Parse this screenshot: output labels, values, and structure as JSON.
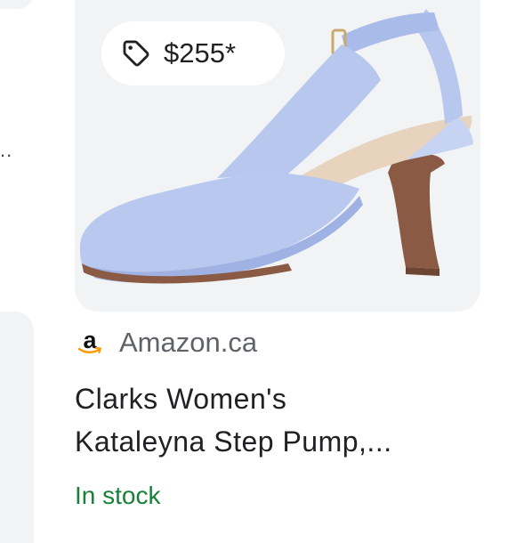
{
  "colors": {
    "card_bg": "#f1f3f4",
    "stock_green": "#188038",
    "shoe_blue": "#b7c7ee",
    "heel_brown": "#8a5a44"
  },
  "left_column": {
    "ellipsis": ".."
  },
  "product": {
    "price": "$255*",
    "price_icon": "tag-icon",
    "merchant_logo_letter": "a",
    "merchant": "Amazon.ca",
    "title_line1": "Clarks Women's",
    "title_line2": "Kataleyna Step Pump,...",
    "availability": "In stock"
  }
}
